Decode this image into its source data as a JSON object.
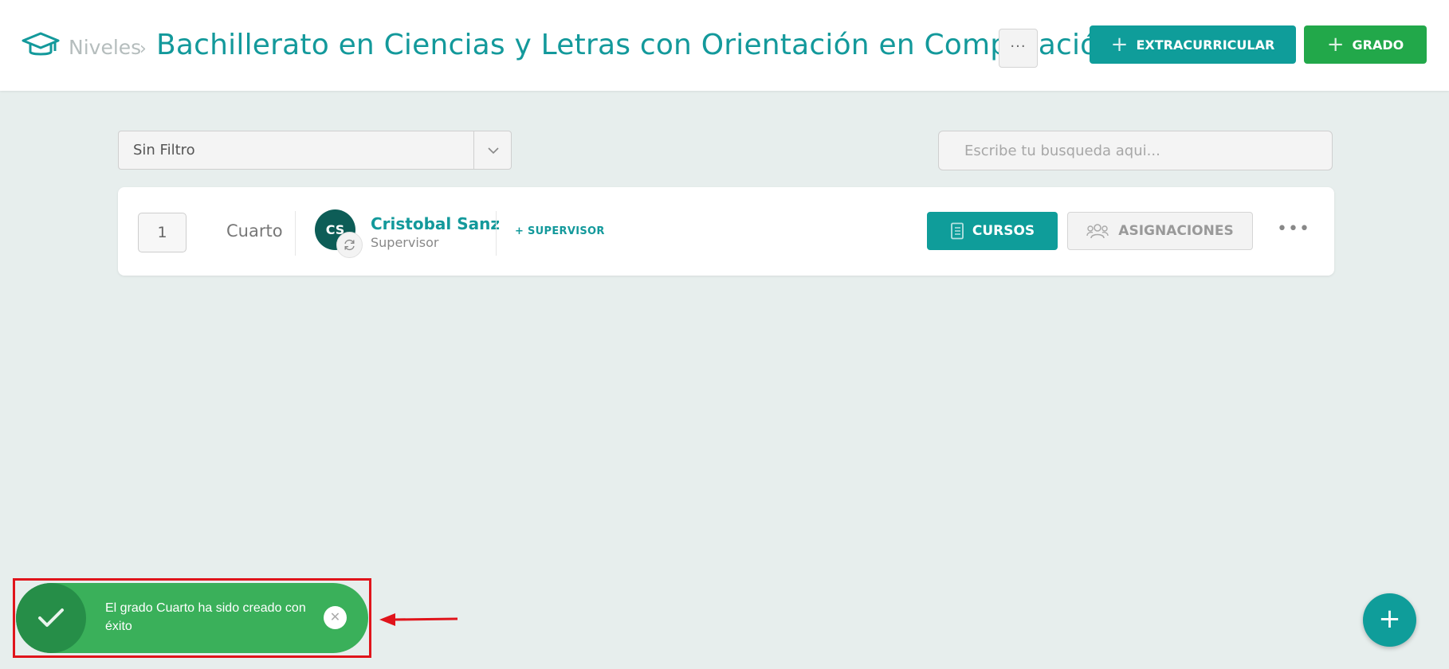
{
  "header": {
    "breadcrumb_root": "Niveles",
    "breadcrumb_separator": "›",
    "title": "Bachillerato en Ciencias y Letras con Orientación en Computación",
    "more_label": "···",
    "btn_extracurricular": "EXTRACURRICULAR",
    "btn_grado": "GRADO",
    "icon": "graduation-cap-icon"
  },
  "filters": {
    "select_value": "Sin Filtro",
    "search_placeholder": "Escribe tu busqueda aqui..."
  },
  "grade": {
    "order": "1",
    "name": "Cuarto",
    "supervisor_initials": "CS",
    "supervisor_name": "Cristobal Sanz",
    "supervisor_role": "Supervisor",
    "add_supervisor_label": "+ SUPERVISOR",
    "cursos_label": "CURSOS",
    "asignaciones_label": "ASIGNACIONES",
    "more_label": "•••"
  },
  "toast": {
    "message": "El grado Cuarto ha sido creado con éxito",
    "close_label": "✕"
  },
  "fab": {
    "label": "+"
  },
  "colors": {
    "teal": "#0f9d9a",
    "green": "#22a84a",
    "toast_green": "#3ab05a",
    "highlight_red": "#e0141b",
    "avatar_dark": "#0d5d57"
  }
}
